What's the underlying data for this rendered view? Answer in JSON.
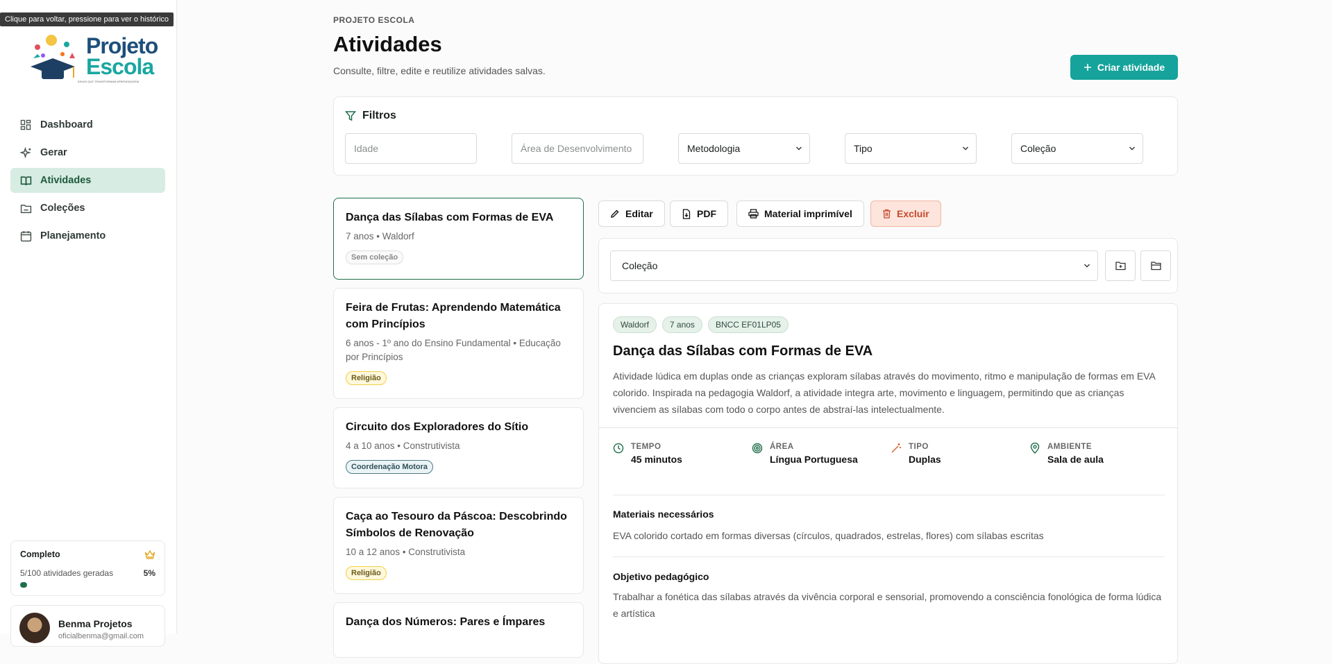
{
  "tooltip": "Clique para voltar, pressione para ver o histórico",
  "brand": {
    "line1": "Projeto",
    "line2": "Escola",
    "tagline": "IDEIAS QUE TRANSFORMAM APRENDIZAGEM"
  },
  "sidebar": {
    "items": [
      {
        "label": "Dashboard",
        "icon": "grid-icon"
      },
      {
        "label": "Gerar",
        "icon": "sparkles-icon"
      },
      {
        "label": "Atividades",
        "icon": "book-open-icon",
        "active": true
      },
      {
        "label": "Coleções",
        "icon": "folder-icon"
      },
      {
        "label": "Planejamento",
        "icon": "calendar-icon"
      }
    ],
    "plan": {
      "title": "Completo",
      "usage": "5/100 atividades geradas",
      "percent": "5%",
      "progress": 0.05
    },
    "user": {
      "name": "Benma Projetos",
      "email": "oficialbenma@gmail.com"
    }
  },
  "header": {
    "kicker": "PROJETO ESCOLA",
    "title": "Atividades",
    "subtitle": "Consulte, filtre, edite e reutilize atividades salvas.",
    "create_label": "Criar atividade"
  },
  "filters": {
    "title": "Filtros",
    "age_placeholder": "Idade",
    "area_placeholder": "Área de Desenvolvimento",
    "methodology": "Metodologia",
    "type": "Tipo",
    "collection": "Coleção"
  },
  "activities": [
    {
      "title": "Dança das Sílabas com Formas de EVA",
      "meta": "7 anos • Waldorf",
      "chip": "Sem coleção",
      "chip_style": "gray"
    },
    {
      "title": "Feira de Frutas: Aprendendo Matemática com Princípios",
      "meta": "6 anos - 1º ano do Ensino Fundamental • Educação por Princípios",
      "chip": "Religião",
      "chip_style": "yellow"
    },
    {
      "title": "Circuito dos Exploradores do Sítio",
      "meta": "4 a 10 anos • Construtivista",
      "chip": "Coordenação Motora",
      "chip_style": "teal"
    },
    {
      "title": "Caça ao Tesouro da Páscoa: Descobrindo Símbolos de Renovação",
      "meta": "10 a 12 anos • Construtivista",
      "chip": "Religião",
      "chip_style": "yellow"
    },
    {
      "title": "Dança dos Números: Pares e Ímpares",
      "meta": "",
      "chip": "",
      "chip_style": ""
    }
  ],
  "toolbar": {
    "edit": "Editar",
    "pdf": "PDF",
    "print": "Material imprimível",
    "delete": "Excluir"
  },
  "collection_select": "Coleção",
  "detail": {
    "tags": [
      "Waldorf",
      "7 anos",
      "BNCC EF01LP05"
    ],
    "title": "Dança das Sílabas com Formas de EVA",
    "description": "Atividade lúdica em duplas onde as crianças exploram sílabas através do movimento, ritmo e manipulação de formas em EVA colorido. Inspirada na pedagogia Waldorf, a atividade integra arte, movimento e linguagem, permitindo que as crianças vivenciem as sílabas com todo o corpo antes de abstraí-las intelectualmente.",
    "stats": [
      {
        "label": "TEMPO",
        "value": "45 minutos",
        "icon": "clock-icon"
      },
      {
        "label": "ÁREA",
        "value": "Língua Portuguesa",
        "icon": "target-icon"
      },
      {
        "label": "TIPO",
        "value": "Duplas",
        "icon": "wand-icon"
      },
      {
        "label": "AMBIENTE",
        "value": "Sala de aula",
        "icon": "map-pin-icon"
      }
    ],
    "materials_title": "Materiais necessários",
    "materials_text": "EVA colorido cortado em formas diversas (círculos, quadrados, estrelas, flores) com sílabas escritas",
    "objective_title": "Objetivo pedagógico",
    "objective_text": "Trabalhar a fonética das sílabas através da vivência corporal e sensorial, promovendo a consciência fonológica de forma lúdica e artística"
  },
  "colors": {
    "accent": "#15a39b",
    "active_nav": "#d7ece2",
    "selected_border": "#1f6e4b",
    "danger": "#c44a2a"
  }
}
